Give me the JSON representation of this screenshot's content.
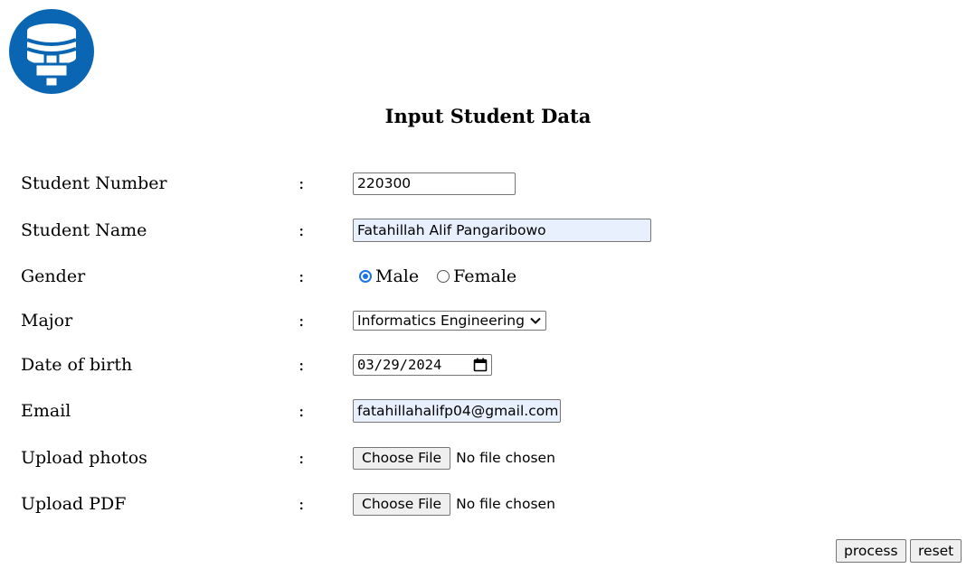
{
  "page": {
    "title": "Input Student Data"
  },
  "form": {
    "student_number": {
      "label": "Student Number",
      "colon": ":",
      "value": "220300"
    },
    "student_name": {
      "label": "Student Name",
      "colon": ":",
      "value": "Fatahillah Alif Pangaribowo"
    },
    "gender": {
      "label": "Gender",
      "colon": ":",
      "options": [
        {
          "label": "Male",
          "checked": true
        },
        {
          "label": "Female",
          "checked": false
        }
      ]
    },
    "major": {
      "label": "Major",
      "colon": ":",
      "selected": "Informatics Engineering"
    },
    "date_of_birth": {
      "label": "Date of birth",
      "colon": ":",
      "value": "03/29/2024"
    },
    "email": {
      "label": "Email",
      "colon": ":",
      "value": "fatahillahalifp04@gmail.com"
    },
    "upload_photos": {
      "label": "Upload photos",
      "colon": ":",
      "button": "Choose File",
      "status": "No file chosen"
    },
    "upload_pdf": {
      "label": "Upload PDF",
      "colon": ":",
      "button": "Choose File",
      "status": "No file chosen"
    }
  },
  "actions": {
    "process": "process",
    "reset": "reset"
  },
  "colors": {
    "logo": "#0a66b2",
    "radio_checked": "#1a73e8",
    "autofill_bg": "#e8f0fe"
  },
  "icons": {
    "logo": "database-plus-icon",
    "select": "chevron-down-icon",
    "date": "calendar-icon"
  }
}
